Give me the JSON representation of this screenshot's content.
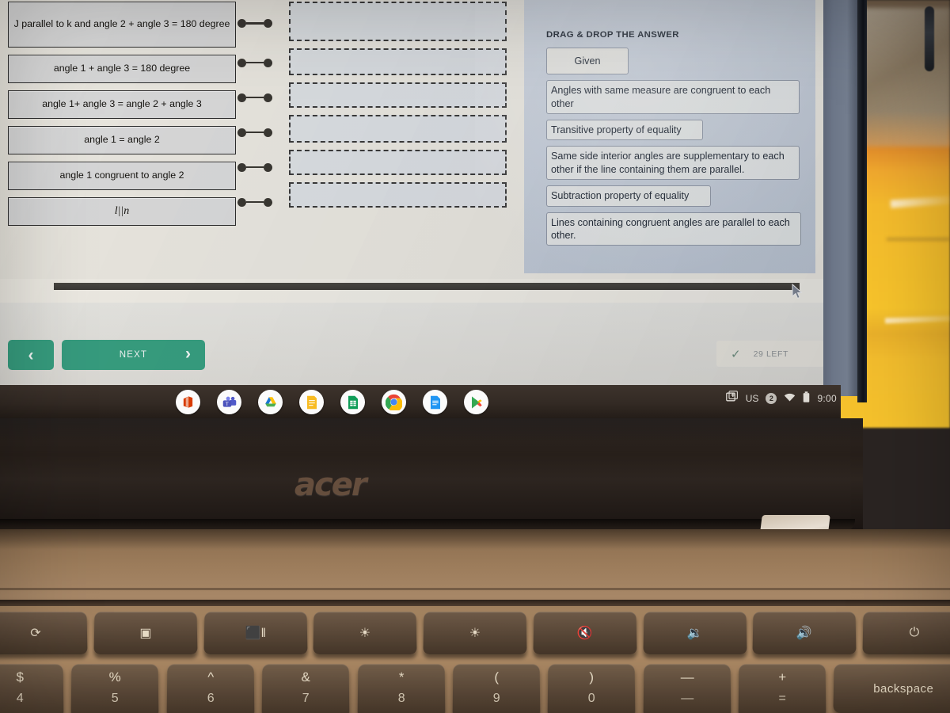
{
  "worksheet": {
    "statements": [
      {
        "text": "J parallel to k and angle 2 + angle 3 = 180 degree",
        "math": false
      },
      {
        "text": "angle 1 + angle 3 = 180 degree",
        "math": false
      },
      {
        "text": "angle 1+ angle 3 = angle 2 + angle 3",
        "math": false
      },
      {
        "text": "angle 1 = angle 2",
        "math": false
      },
      {
        "text": "angle 1 congruent to angle 2",
        "math": false
      },
      {
        "text": "l||n",
        "math": true
      }
    ],
    "dropzones": [
      "",
      "",
      "",
      "",
      "",
      ""
    ]
  },
  "answers_panel": {
    "title": "DRAG & DROP THE ANSWER",
    "items": [
      "Given",
      "Angles with same measure are congruent to each other",
      "Transitive property of equality",
      "Same side interior angles are supplementary to each other if the line containing them are parallel.",
      "Subtraction property of equality",
      "Lines containing congruent angles are parallel to each other."
    ]
  },
  "appbar": {
    "prev_label": "‹",
    "next_label": "NEXT",
    "next_chevron": "›",
    "check_icon": "✓",
    "left_count": "29 LEFT"
  },
  "shelf": {
    "icons": [
      {
        "name": "microsoft-office-icon",
        "label": "Office"
      },
      {
        "name": "microsoft-teams-icon",
        "label": "Teams"
      },
      {
        "name": "google-drive-icon",
        "label": "Drive"
      },
      {
        "name": "google-keep-icon",
        "label": "Keep"
      },
      {
        "name": "google-sheets-icon",
        "label": "Sheets"
      },
      {
        "name": "google-chrome-icon",
        "label": "Chrome"
      },
      {
        "name": "google-docs-icon",
        "label": "Docs"
      },
      {
        "name": "google-play-icon",
        "label": "Play Store"
      }
    ],
    "tray": {
      "cast_icon": "screen-capture-icon",
      "keyboard_layout": "US",
      "notification_count": "2",
      "wifi_icon": "wifi-icon",
      "battery_icon": "battery-icon",
      "clock": "9:00"
    }
  },
  "laptop": {
    "brand": "acer",
    "function_keys": [
      "⟳",
      "▣",
      "⬛‖",
      "☀",
      "☀",
      "🔇",
      "🔉",
      "🔊",
      "⏻"
    ],
    "number_keys": [
      {
        "top": "$",
        "bottom": "4"
      },
      {
        "top": "%",
        "bottom": "5"
      },
      {
        "top": "^",
        "bottom": "6"
      },
      {
        "top": "&",
        "bottom": "7"
      },
      {
        "top": "*",
        "bottom": "8"
      },
      {
        "top": "(",
        "bottom": "9"
      },
      {
        "top": ")",
        "bottom": "0"
      },
      {
        "top": "—",
        "bottom": "—"
      },
      {
        "top": "+",
        "bottom": "="
      }
    ],
    "backspace_label": "backspace"
  },
  "colors": {
    "accent_green": "#379e7f",
    "statement_bg": "#d9d9d9",
    "worksheet_bg": "#eae7df",
    "answers_bg": "#c7cfdb"
  }
}
